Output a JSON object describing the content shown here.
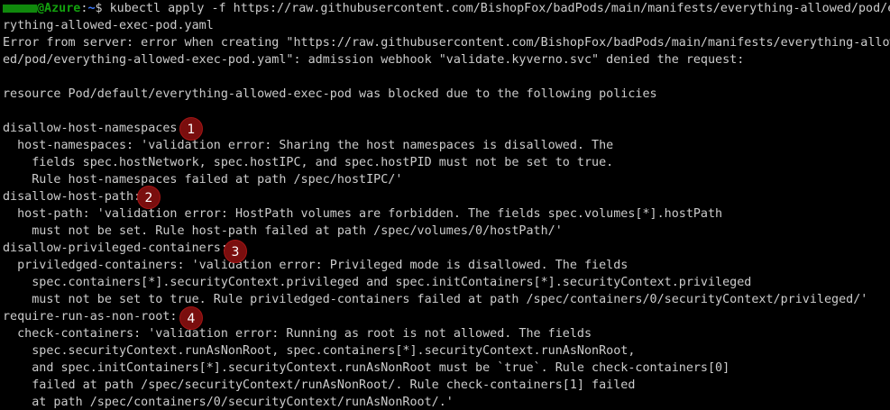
{
  "prompt": {
    "host": "@Azure",
    "separator": ":",
    "cwd": "~",
    "symbol": "$ "
  },
  "command": "kubectl apply -f https://raw.githubusercontent.com/BishopFox/badPods/main/manifests/everything-allowed/pod/eve",
  "output": [
    "rything-allowed-exec-pod.yaml",
    "Error from server: error when creating \"https://raw.githubusercontent.com/BishopFox/badPods/main/manifests/everything-allow",
    "ed/pod/everything-allowed-exec-pod.yaml\": admission webhook \"validate.kyverno.svc\" denied the request:",
    "",
    "resource Pod/default/everything-allowed-exec-pod was blocked due to the following policies",
    "",
    "disallow-host-namespaces:",
    "  host-namespaces: 'validation error: Sharing the host namespaces is disallowed. The",
    "    fields spec.hostNetwork, spec.hostIPC, and spec.hostPID must not be set to true.",
    "    Rule host-namespaces failed at path /spec/hostIPC/'",
    "disallow-host-path:",
    "  host-path: 'validation error: HostPath volumes are forbidden. The fields spec.volumes[*].hostPath",
    "    must not be set. Rule host-path failed at path /spec/volumes/0/hostPath/'",
    "disallow-privileged-containers:",
    "  priviledged-containers: 'validation error: Privileged mode is disallowed. The fields",
    "    spec.containers[*].securityContext.privileged and spec.initContainers[*].securityContext.privileged",
    "    must not be set to true. Rule priviledged-containers failed at path /spec/containers/0/securityContext/privileged/'",
    "require-run-as-non-root:",
    "  check-containers: 'validation error: Running as root is not allowed. The fields",
    "    spec.securityContext.runAsNonRoot, spec.containers[*].securityContext.runAsNonRoot,",
    "    and spec.initContainers[*].securityContext.runAsNonRoot must be `true`. Rule check-containers[0]",
    "    failed at path /spec/securityContext/runAsNonRoot/. Rule check-containers[1] failed",
    "    at path /spec/containers/0/securityContext/runAsNonRoot/.'"
  ],
  "badges": [
    "1",
    "2",
    "3",
    "4"
  ],
  "colors": {
    "background": "#000000",
    "text": "#cccccc",
    "prompt_user": "#13a10e",
    "prompt_cwd": "#3b78ff",
    "badge": "#7a0e0e"
  }
}
